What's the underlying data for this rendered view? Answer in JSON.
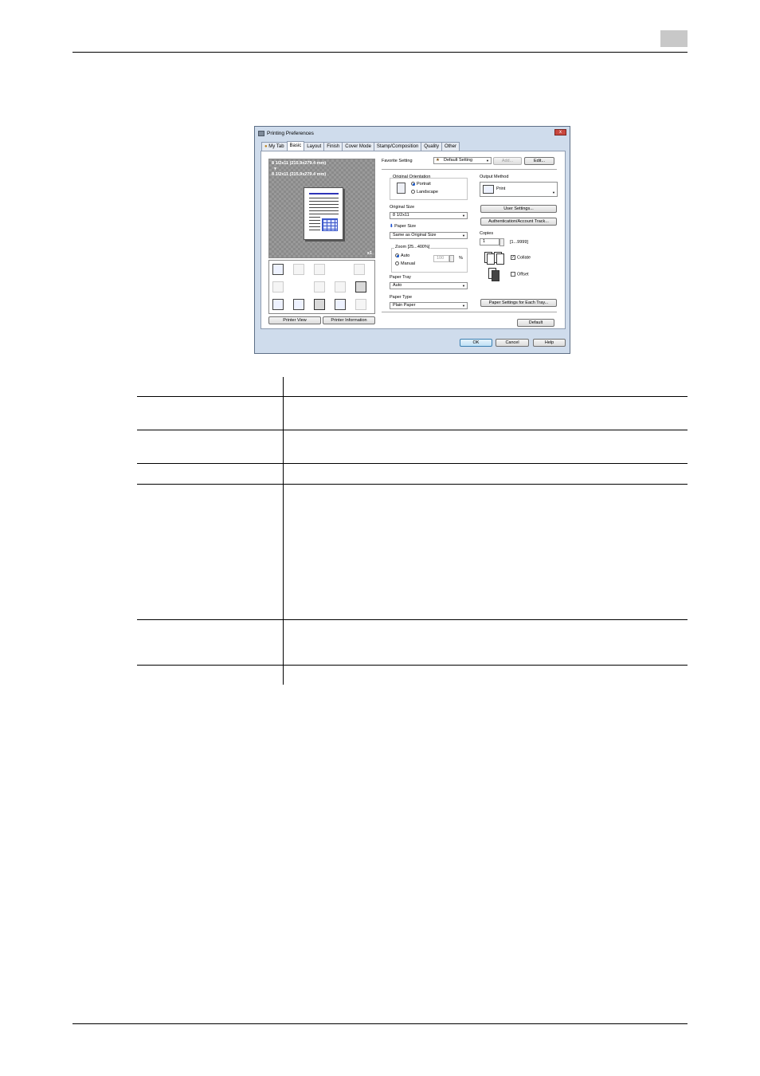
{
  "dialog": {
    "title": "Printing Preferences",
    "close_glyph": "x",
    "tabs": [
      "My Tab",
      "Basic",
      "Layout",
      "Finish",
      "Cover Mode",
      "Stamp/Composition",
      "Quality",
      "Other"
    ],
    "active_tab": "Basic",
    "preview": {
      "original_size_text": "8 1/2x11 (215.9x279.4 mm)",
      "arrow": "▼",
      "paper_size_text": "8 1/2x11 (215.9x279.4 mm)",
      "copies_marker": "x1"
    },
    "printer_view_label": "Printer View",
    "printer_information_label": "Printer Information",
    "favorite_setting": {
      "label": "Favorite Setting",
      "value": "Default Setting",
      "add_label": "Add...",
      "edit_label": "Edit..."
    },
    "original_orientation": {
      "label": "Original Orientation",
      "portrait": "Portrait",
      "landscape": "Landscape",
      "selected": "Portrait"
    },
    "original_size": {
      "label": "Original Size",
      "value": "8 1/2x11"
    },
    "paper_size": {
      "label": "Paper Size",
      "value": "Same as Original Size"
    },
    "zoom": {
      "label": "Zoom [25...400%]",
      "auto": "Auto",
      "manual": "Manual",
      "value": "100",
      "unit": "%",
      "selected": "Auto"
    },
    "paper_tray": {
      "label": "Paper Tray",
      "value": "Auto"
    },
    "paper_type": {
      "label": "Paper Type",
      "value": "Plain Paper"
    },
    "output_method": {
      "label": "Output Method",
      "value": "Print"
    },
    "user_settings_label": "User Settings...",
    "authentication_label": "Authentication/Account Track...",
    "copies": {
      "label": "Copies",
      "value": "1",
      "range": "[1...9999]"
    },
    "collate": {
      "label": "Collate",
      "checked": true
    },
    "offset": {
      "label": "Offset",
      "checked": false
    },
    "paper_settings_label": "Paper Settings for Each Tray...",
    "default_label": "Default",
    "ok_label": "OK",
    "cancel_label": "Cancel",
    "help_label": "Help"
  }
}
